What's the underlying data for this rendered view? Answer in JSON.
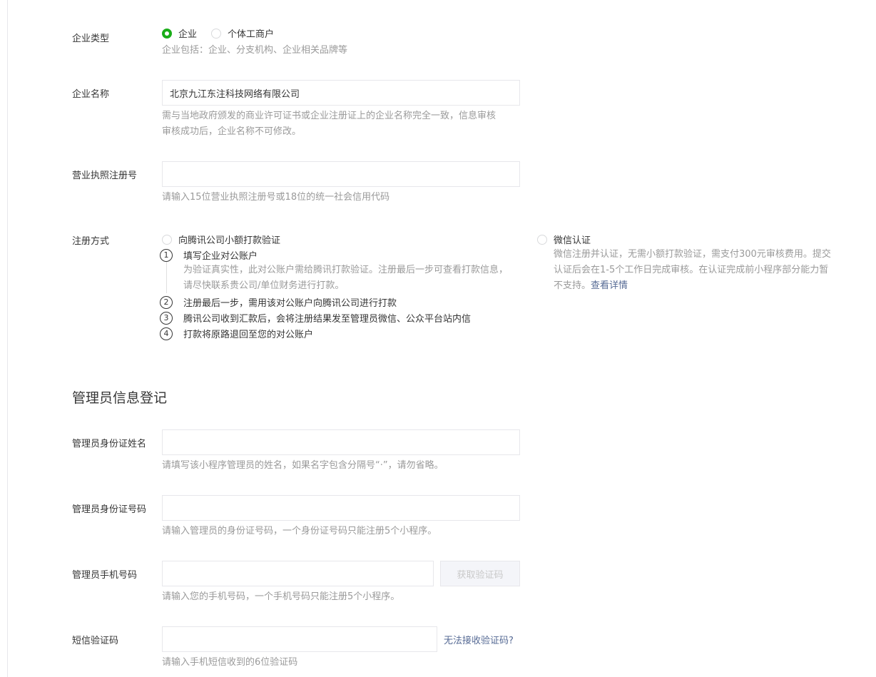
{
  "enterprise_type": {
    "label": "企业类型",
    "options": [
      {
        "label": "企业",
        "checked": true
      },
      {
        "label": "个体工商户",
        "checked": false
      }
    ],
    "tip": "企业包括：企业、分支机构、企业相关品牌等"
  },
  "enterprise_name": {
    "label": "企业名称",
    "value": "北京九江东注科技网络有限公司",
    "tip_line1": "需与当地政府颁发的商业许可证书或企业注册证上的企业名称完全一致，信息审核",
    "tip_line2": "审核成功后，企业名称不可修改。"
  },
  "license_number": {
    "label": "营业执照注册号",
    "value": "",
    "tip": "请输入15位营业执照注册号或18位的统一社会信用代码"
  },
  "register_method": {
    "label": "注册方式",
    "option_transfer": {
      "label": "向腾讯公司小额打款验证",
      "checked": false,
      "steps": [
        {
          "num": "1",
          "text": "填写企业对公账户"
        },
        {
          "num": "2",
          "text": "注册最后一步，需用该对公账户向腾讯公司进行打款"
        },
        {
          "num": "3",
          "text": "腾讯公司收到汇款后，会将注册结果发至管理员微信、公众平台站内信"
        },
        {
          "num": "4",
          "text": "打款将原路退回至您的对公账户"
        }
      ],
      "step1_desc_line1": "为验证真实性，此对公账户需给腾讯打款验证。注册最后一步可查看打款信息，",
      "step1_desc_line2": "请尽快联系贵公司/单位财务进行打款。"
    },
    "option_wechat": {
      "label": "微信认证",
      "checked": false,
      "desc_line1": "微信注册并认证，无需小额打款验证，需支付300元审核费用。提交",
      "desc_line2": "认证后会在1-5个工作日完成审核。在认证完成前小程序部分能力暂",
      "desc_line3": "不支持。",
      "link": "查看详情"
    }
  },
  "admin_section": {
    "title": "管理员信息登记"
  },
  "admin_name": {
    "label": "管理员身份证姓名",
    "value": "",
    "tip": "请填写该小程序管理员的姓名，如果名字包含分隔号“·”，请勿省略。"
  },
  "admin_id": {
    "label": "管理员身份证号码",
    "value": "",
    "tip": "请输入管理员的身份证号码，一个身份证号码只能注册5个小程序。"
  },
  "admin_phone": {
    "label": "管理员手机号码",
    "value": "",
    "button": "获取验证码",
    "tip": "请输入您的手机号码，一个手机号码只能注册5个小程序。"
  },
  "sms_code": {
    "label": "短信验证码",
    "value": "",
    "link": "无法接收验证码?",
    "tip": "请输入手机短信收到的6位验证码"
  },
  "colors": {
    "accent_green": "#1aad19",
    "link_blue": "#576b95",
    "tip_gray": "#9a9a9a"
  }
}
